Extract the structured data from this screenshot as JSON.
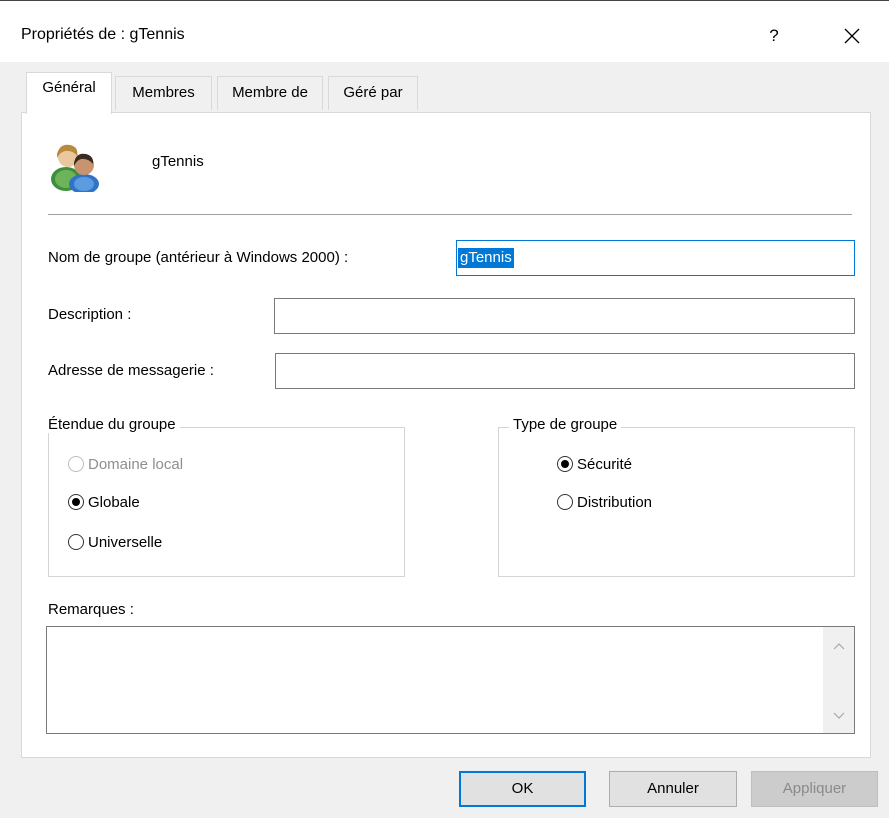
{
  "window": {
    "title": "Propriétés de : gTennis",
    "help": "?",
    "close": "✕"
  },
  "tabs": [
    {
      "label": "Général",
      "active": true
    },
    {
      "label": "Membres",
      "active": false
    },
    {
      "label": "Membre de",
      "active": false
    },
    {
      "label": "Géré par",
      "active": false
    }
  ],
  "general": {
    "group_name": "gTennis",
    "sam_label": "Nom de groupe (antérieur à Windows 2000) :",
    "sam_value": "gTennis",
    "description_label": "Description :",
    "description_value": "",
    "email_label": "Adresse de messagerie :",
    "email_value": "",
    "scope": {
      "legend": "Étendue du groupe",
      "options": [
        {
          "label": "Domaine local",
          "checked": false,
          "enabled": false
        },
        {
          "label": "Globale",
          "checked": true,
          "enabled": true
        },
        {
          "label": "Universelle",
          "checked": false,
          "enabled": true
        }
      ]
    },
    "type": {
      "legend": "Type de groupe",
      "options": [
        {
          "label": "Sécurité",
          "checked": true,
          "enabled": true
        },
        {
          "label": "Distribution",
          "checked": false,
          "enabled": true
        }
      ]
    },
    "notes_label": "Remarques :",
    "notes_value": ""
  },
  "buttons": {
    "ok": "OK",
    "cancel": "Annuler",
    "apply": "Appliquer"
  },
  "icons": {
    "group": "group-users-icon",
    "scroll_up": "chevron-up-icon",
    "scroll_down": "chevron-down-icon"
  },
  "colors": {
    "accent": "#0078d7"
  }
}
